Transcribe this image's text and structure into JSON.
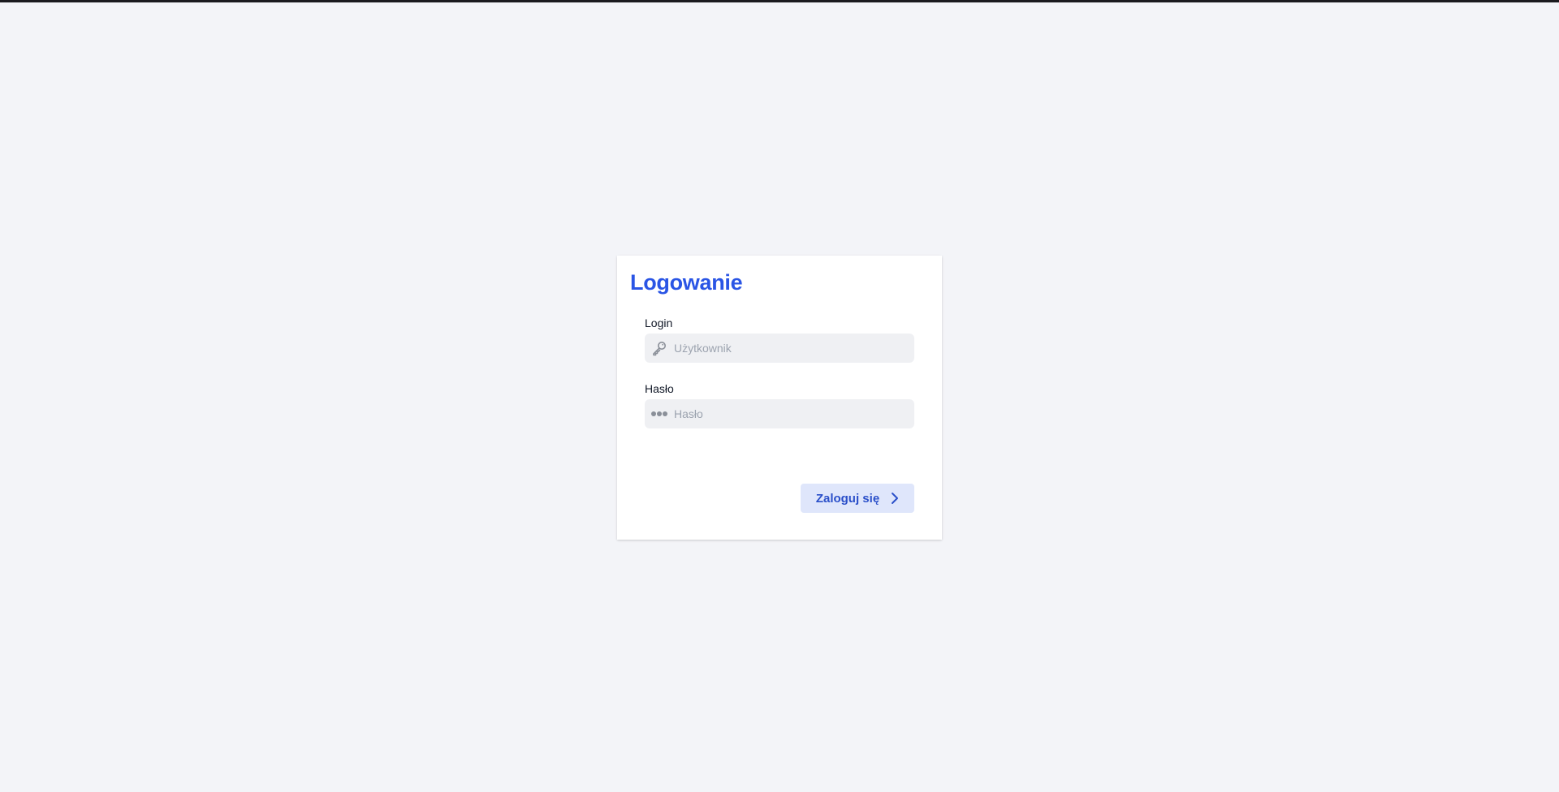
{
  "login_form": {
    "title": "Logowanie",
    "login": {
      "label": "Login",
      "placeholder": "Użytkownik",
      "value": "",
      "icon": "key-icon"
    },
    "password": {
      "label": "Hasło",
      "placeholder": "Hasło",
      "value": "",
      "icon": "password-dots-icon"
    },
    "submit": {
      "label": "Zaloguj się",
      "icon": "chevron-right-icon"
    }
  },
  "colors": {
    "background": "#f3f4f8",
    "accent": "#2a55e5",
    "button_bg": "#dfe6fb",
    "input_bg": "#eff0f3"
  }
}
